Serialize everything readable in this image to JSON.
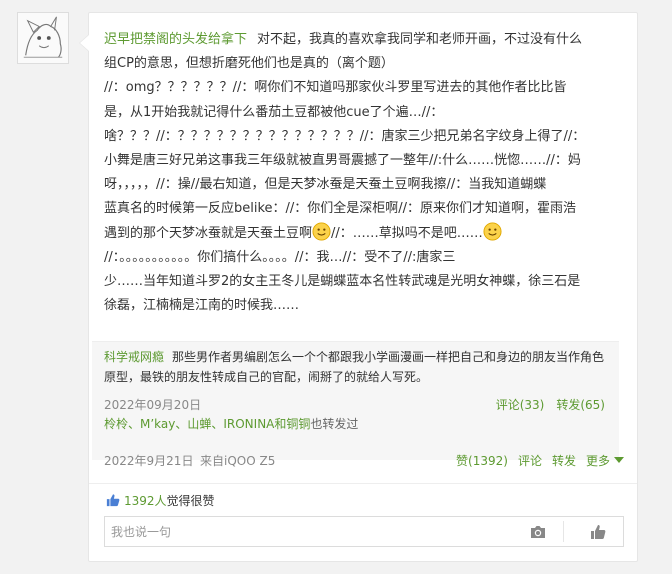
{
  "post": {
    "author": "迟早把禁阁的头发给拿下",
    "lines": [
      "对不起，我真的喜欢拿我同学和老师开画，不过没有什么",
      "组CP的意思，但想折磨死他们也是真的（离个题）",
      "//：omg？？？？？？//：啊你们不知道吗那家伙斗罗里写进去的其他作者比比皆",
      "是，从1开始我就记得什么番茄土豆都被他cue了个遍…//：",
      "啥？？？//：？？？？？？？？？？？？？？//：唐家三少把兄弟名字纹身上得了//：",
      "小舞是唐三好兄弟这事我三年级就被直男哥震撼了一整年//:什么……恍惚……//：妈",
      "呀，，，，，//：操//最右知道，但是天梦冰蚕是天蚕土豆啊我擦//：当我知道蝴蝶",
      "蓝真名的时候第一反应belike：//：你们全是深柜啊//：原来你们才知道啊，霍雨浩",
      "遇到的那个天梦冰蚕就是天蚕土豆啊",
      "//：……草拟吗不是吧……",
      "//：。。。。。。。。。。。你们搞什么。。。。//：我…//：受不了//:唐家三",
      "少……当年知道斗罗2的女主王冬儿是蝴蝶蓝本名性转武魂是光明女神蝶，徐三石是",
      "徐磊，江楠楠是江南的时候我……"
    ]
  },
  "repost": {
    "author": "科学戒网瘾",
    "text": "那些男作者男编剧怎么一个个都跟我小学画漫画一样把自己和身边的朋友当作角色原型，最铁的朋友性转成自己的官配，闹掰了的就给人写死。",
    "date": "2022年09月20日",
    "comment_label": "评论(33)",
    "forward_label": "转发(65)",
    "also_names": "柃柃、M’kay、山蝉、IRONINA和铜铜",
    "also_suffix": "也转发过"
  },
  "meta": {
    "time": "2022年9月21日",
    "source": "来自iQOO Z5",
    "like_label": "赞(1392)",
    "comment_label": "评论",
    "forward_label": "转发",
    "more_label": "更多"
  },
  "likes": {
    "count": "1392人",
    "suffix": "觉得很赞"
  },
  "comment_box": {
    "placeholder": "我也说一句"
  },
  "icons": {
    "avatar": "avatar-illustration",
    "smile": "smile-emoji-icon",
    "thumb": "thumb-up-icon",
    "camera": "camera-icon",
    "like": "like-hand-icon"
  },
  "colors": {
    "accent": "#5d9a31",
    "background": "#f2f2f2"
  }
}
